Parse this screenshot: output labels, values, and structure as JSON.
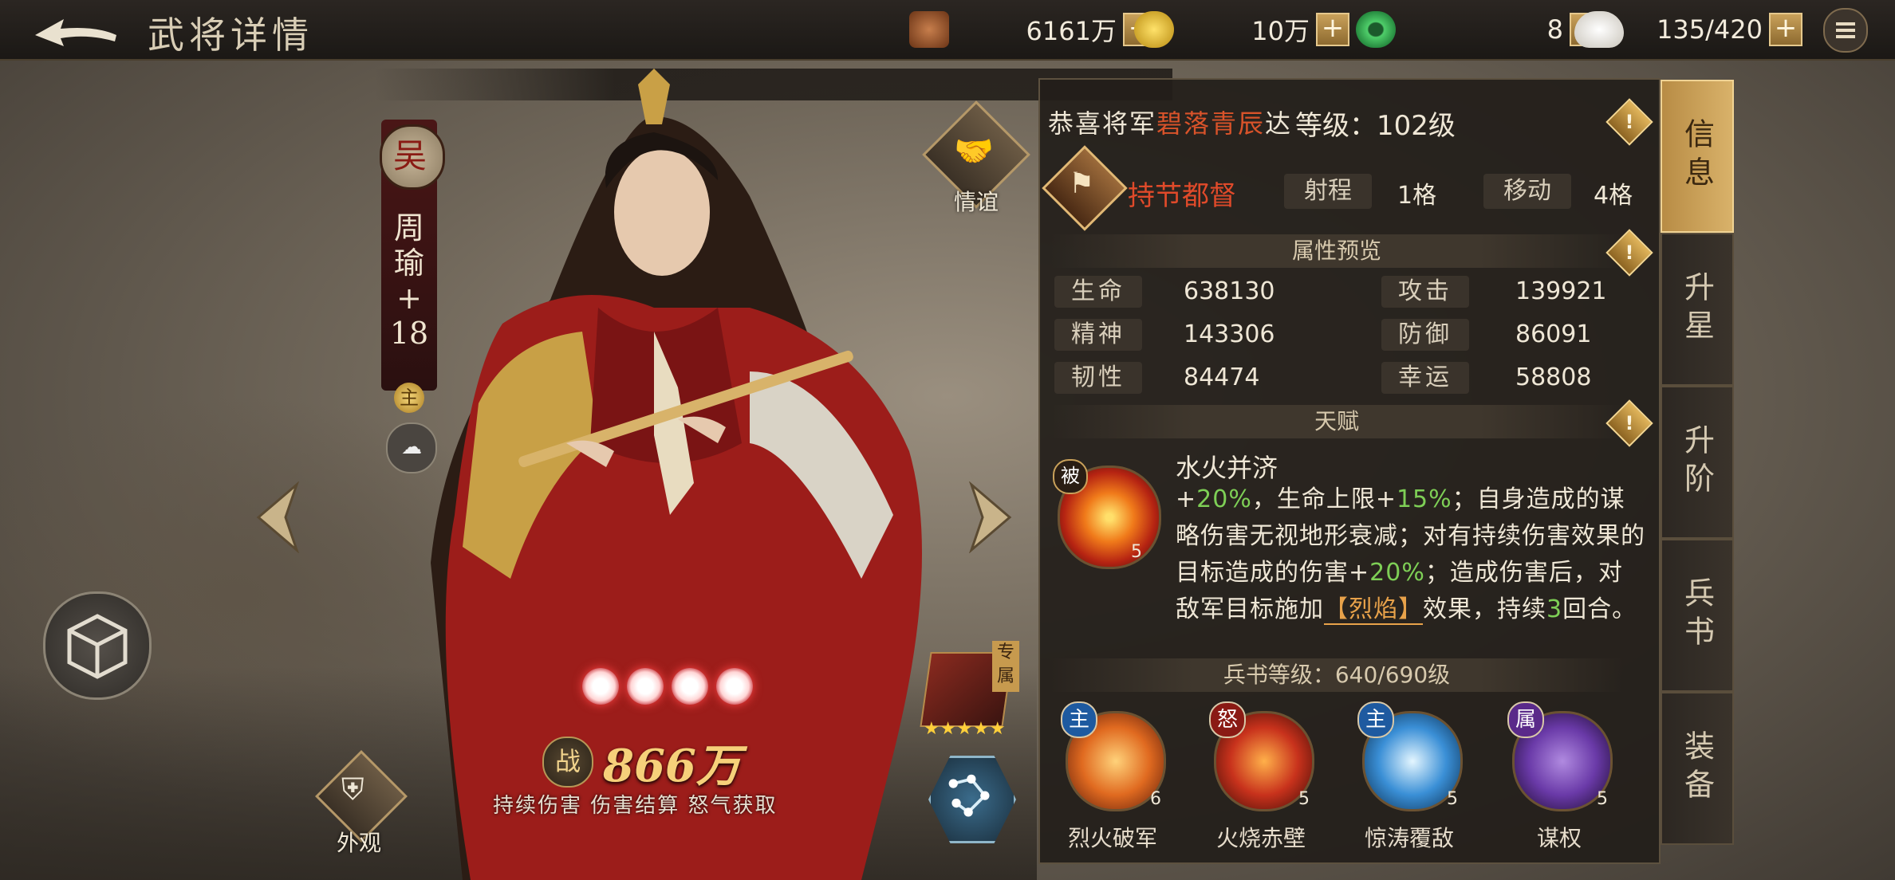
{
  "header": {
    "title": "武将详情",
    "resources": [
      {
        "icon": "copper-coin-icon",
        "value": "6161万"
      },
      {
        "icon": "gold-coin-icon",
        "value": "10万"
      },
      {
        "icon": "jade-icon",
        "value": "8"
      },
      {
        "icon": "rice-icon",
        "value": "135/420"
      }
    ],
    "plus_label": "+"
  },
  "hero": {
    "faction": "吴",
    "name_chars": [
      "周",
      "瑜",
      "+",
      "18"
    ],
    "role_badge": "主",
    "bond_label": "情谊",
    "skin_label": "外观",
    "power_icon_label": "战",
    "power": "866万",
    "tags": "持续伤害 伤害结算 怒气获取",
    "exclusive_tag": "专属",
    "weapon_stars": "★★★★★",
    "awaken_orbs": 4
  },
  "info": {
    "congrats_prefix": "恭喜将军",
    "congrats_highlight": "碧落青辰",
    "congrats_suffix": "达",
    "level_label": "等级：",
    "level_value": "102级",
    "class_name": "持节都督",
    "range_label": "射程",
    "range_value": "1格",
    "move_label": "移动",
    "move_value": "4格",
    "attributes_title": "属性预览",
    "attributes": [
      {
        "label": "生命",
        "value": "638130"
      },
      {
        "label": "攻击",
        "value": "139921"
      },
      {
        "label": "精神",
        "value": "143306"
      },
      {
        "label": "防御",
        "value": "86091"
      },
      {
        "label": "韧性",
        "value": "84474"
      },
      {
        "label": "幸运",
        "value": "58808"
      }
    ],
    "talent_title": "天赋",
    "talent": {
      "tag": "被",
      "level": "5",
      "name": "水火并济",
      "desc_parts": {
        "p1": "+",
        "p2": "20%",
        "p3": "，生命上限+",
        "p4": "15%",
        "p5": "；自身造成的谋略伤害无视地形衰减；对有持续伤害效果的目标造成的伤害+",
        "p6": "20%",
        "p7": "；造成伤害后，对敌军目标施加",
        "p8": "【烈焰】",
        "p9": "效果，持续",
        "p10": "3",
        "p11": "回合。"
      }
    },
    "book_label": "兵书等级：",
    "book_value": "640/690级",
    "skills": [
      {
        "tag": "主",
        "level": "6",
        "name": "烈火破军",
        "color": "#e06a20"
      },
      {
        "tag": "怒",
        "level": "5",
        "name": "火烧赤壁",
        "color": "#c8321c"
      },
      {
        "tag": "主",
        "level": "5",
        "name": "惊涛覆敌",
        "color": "#3a8fd6"
      },
      {
        "tag": "属",
        "level": "5",
        "name": "谋权",
        "color": "#6a3aa8"
      }
    ]
  },
  "tabs": [
    {
      "label": "信息",
      "active": true
    },
    {
      "label": "升星",
      "active": false
    },
    {
      "label": "升阶",
      "active": false
    },
    {
      "label": "兵书",
      "active": false
    },
    {
      "label": "装备",
      "active": false
    }
  ],
  "colors": {
    "accent_gold": "#d9b26a",
    "class_red": "#e04a2a",
    "percent_green": "#7ecf56"
  }
}
